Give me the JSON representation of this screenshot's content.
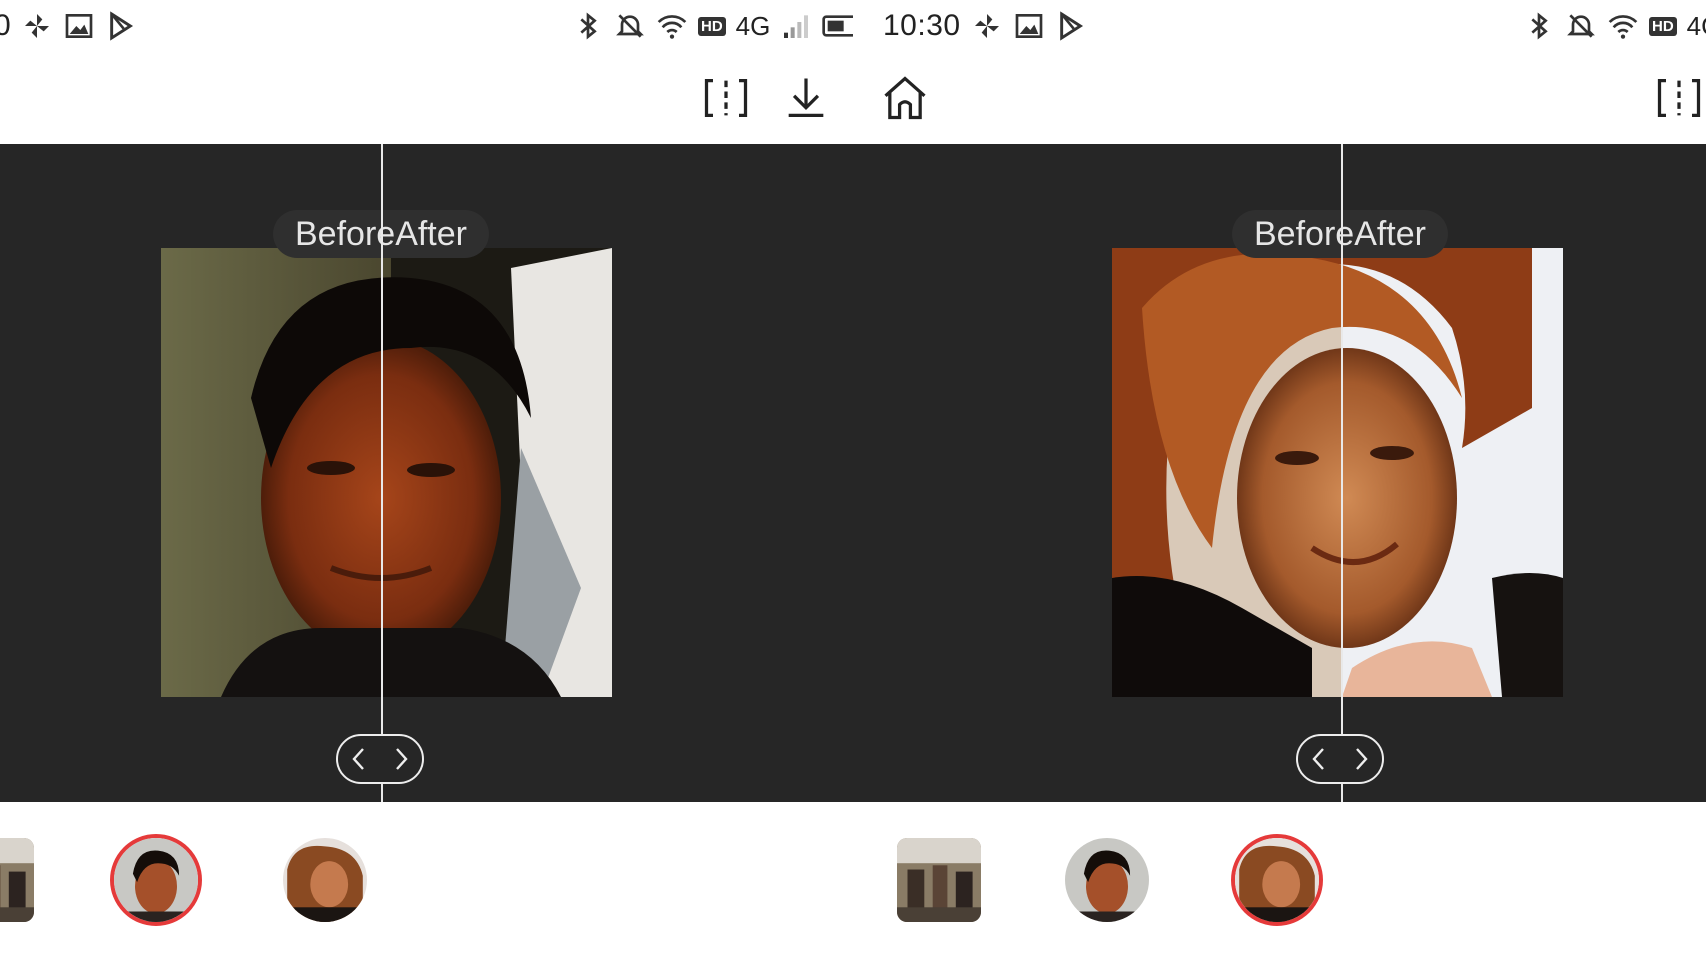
{
  "left_pane": {
    "status_bar": {
      "time_fragment": "0",
      "network": "4G",
      "hd": "HD"
    },
    "viewer": {
      "before_label": "Before",
      "after_label": "After"
    }
  },
  "right_pane": {
    "status_bar": {
      "time": "10:30",
      "network": "4G",
      "hd": "HD"
    },
    "viewer": {
      "before_label": "Before",
      "after_label": "After"
    }
  },
  "icons": {
    "status_left": [
      "pinwheel-icon",
      "image-icon",
      "play-store-icon"
    ],
    "status_right": [
      "bluetooth-icon",
      "mute-icon",
      "wifi-icon",
      "signal-icon",
      "battery-icon"
    ],
    "toolbar": [
      "compare-split-icon",
      "download-icon",
      "home-icon"
    ],
    "handle": [
      "chevron-left-icon",
      "chevron-right-icon"
    ]
  },
  "colors": {
    "viewer_bg": "#262626",
    "selected_ring": "#e53a3a",
    "divider": "#e9e9e9"
  }
}
